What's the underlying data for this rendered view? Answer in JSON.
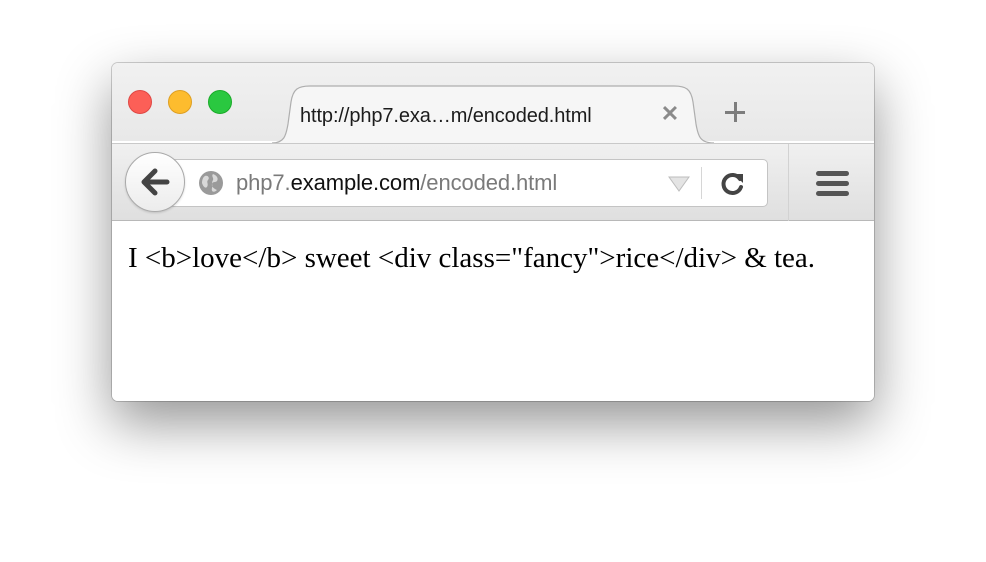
{
  "tab": {
    "title": "http://php7.exa…m/encoded.html",
    "close_glyph": "✕"
  },
  "address_bar": {
    "url_prefix": "php7.",
    "url_domain": "example.com",
    "url_path": "/encoded.html"
  },
  "page": {
    "text": "I <b>love</b> sweet <div class=\"fancy\">rice</div> & tea."
  },
  "icons": {
    "back": "back-arrow-icon",
    "site_identity": "globe-icon",
    "history_dropmarker": "dropdown-triangle-icon",
    "reload": "reload-icon",
    "menu": "hamburger-menu-icon",
    "new_tab": "plus-icon"
  },
  "colors": {
    "close": "#fc5f57",
    "minimize": "#fdbc2e",
    "zoom": "#2ac840"
  }
}
